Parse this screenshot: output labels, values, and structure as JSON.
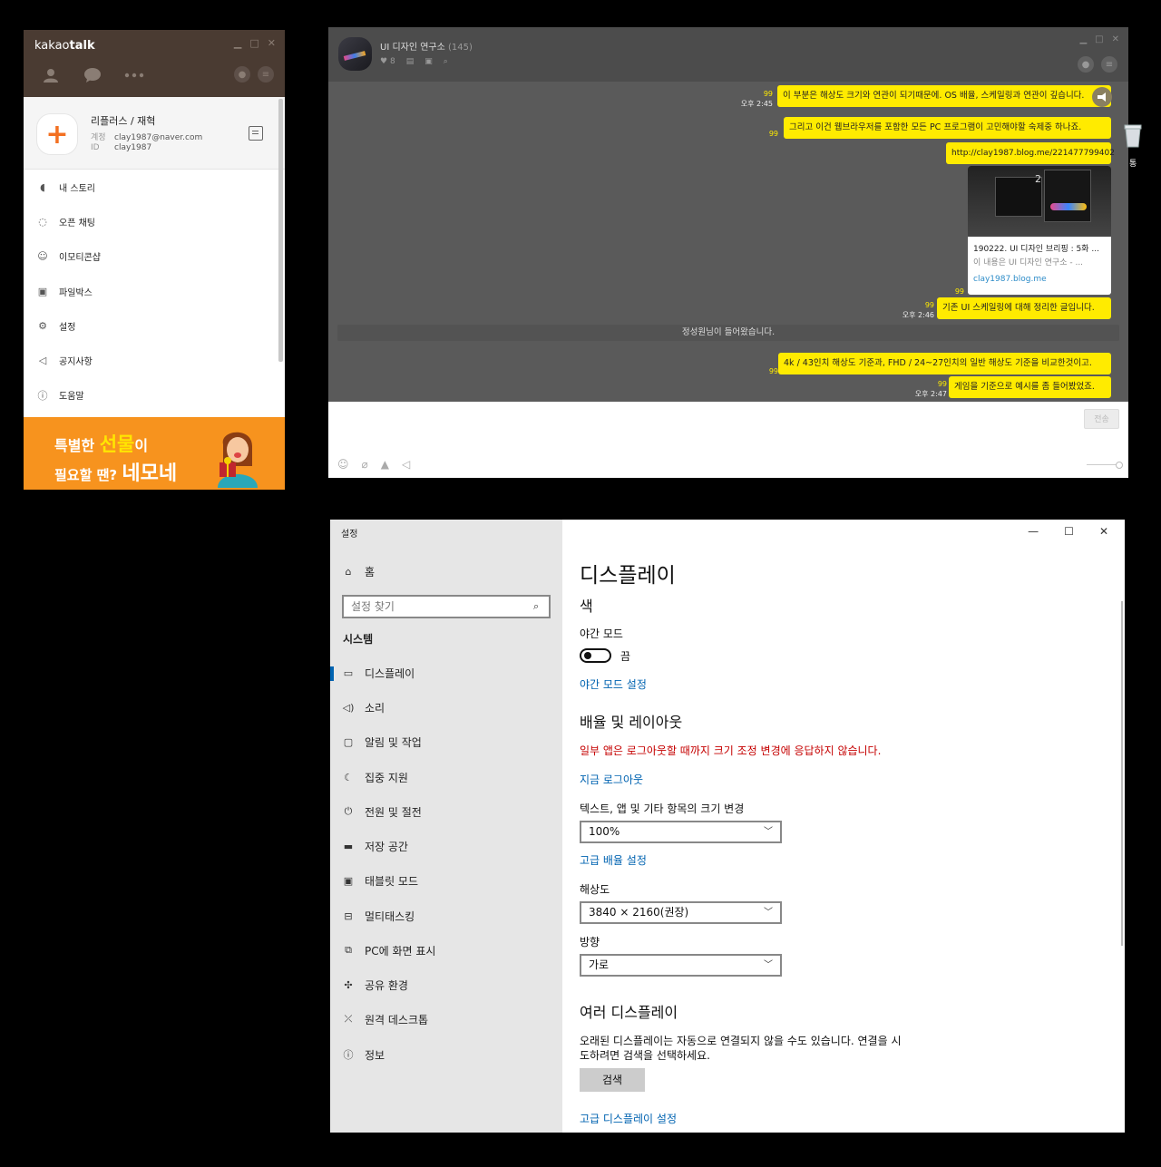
{
  "kakao": {
    "logo_prefix": "kakao",
    "logo_bold": "talk",
    "profile": {
      "name": "리플러스 / 재혁",
      "account_label": "계정",
      "account": "clay1987@naver.com",
      "id_label": "ID",
      "id": "clay1987"
    },
    "menu": [
      {
        "label": "내 스토리",
        "icon": "story-icon"
      },
      {
        "label": "오픈 채팅",
        "icon": "open-chat-icon"
      },
      {
        "label": "이모티콘샵",
        "icon": "emoticon-icon"
      },
      {
        "label": "파일박스",
        "icon": "filebox-icon"
      },
      {
        "label": "설정",
        "icon": "gear-icon"
      },
      {
        "label": "공지사항",
        "icon": "megaphone-icon"
      },
      {
        "label": "도움말",
        "icon": "help-icon"
      }
    ],
    "banner": {
      "line1_pre": "특별한 ",
      "line1_hi": "선물",
      "line1_post": "이",
      "line2_pre": "필요할 땐? ",
      "line2_big": "네모네"
    },
    "colors": {
      "header": "#4a3b32",
      "banner": "#f7931e",
      "accent": "#f37021"
    }
  },
  "chat": {
    "title": "UI 디자인 연구소",
    "member_count": "(145)",
    "likes": "8",
    "messages": [
      {
        "text": "이 부분은 해상도 크기와 연관이 되기때문에. OS 배율, 스케일링과 연관이 깊습니다.",
        "time": "오후 2:45",
        "read": "99"
      },
      {
        "text": "그리고 이건 웹브라우저를 포함한 모든 PC 프로그램이 고민해야할 숙제중 하나죠.",
        "time": "",
        "read": "99"
      },
      {
        "text": "http://clay1987.blog.me/221477799402",
        "time": "",
        "read": ""
      },
      {
        "text": "기존 UI 스케일링에 대해 정리한 글입니다.",
        "time": "오후 2:46",
        "read": "99"
      },
      {
        "text": "4k / 43인치 해상도 기준과, FHD / 24~27인치의 일반 해상도 기준을 비교한것이고.",
        "time": "",
        "read": "99"
      },
      {
        "text": "게임을 기준으로 예시를 좀 들어봤었죠.",
        "time": "오후 2:47",
        "read": "99"
      }
    ],
    "link_card": {
      "thumb_number": "2",
      "title": "190222. UI 디자인 브리핑 : 5화 ...",
      "desc": "이 내용은 UI 디자인 연구소 - ...",
      "url": "clay1987.blog.me",
      "read": "99"
    },
    "notice": "정성원님이 들어왔습니다.",
    "send_label": "전송",
    "colors": {
      "bubble": "#ffeb00",
      "background": "#5a5a5a"
    }
  },
  "desktop": {
    "trash_label": "통"
  },
  "settings": {
    "app_title": "설정",
    "home": "홈",
    "search_placeholder": "설정 찾기",
    "section": "시스템",
    "nav": [
      {
        "label": "디스플레이",
        "icon": "monitor-icon"
      },
      {
        "label": "소리",
        "icon": "speaker-icon"
      },
      {
        "label": "알림 및 작업",
        "icon": "notification-icon"
      },
      {
        "label": "집중 지원",
        "icon": "moon-icon"
      },
      {
        "label": "전원 및 절전",
        "icon": "power-icon"
      },
      {
        "label": "저장 공간",
        "icon": "storage-icon"
      },
      {
        "label": "태블릿 모드",
        "icon": "tablet-icon"
      },
      {
        "label": "멀티태스킹",
        "icon": "multitask-icon"
      },
      {
        "label": "PC에 화면 표시",
        "icon": "project-icon"
      },
      {
        "label": "공유 환경",
        "icon": "share-icon"
      },
      {
        "label": "원격 데스크톱",
        "icon": "remote-icon"
      },
      {
        "label": "정보",
        "icon": "info-icon"
      }
    ],
    "page_title": "디스플레이",
    "color_heading": "색",
    "night_mode_label": "야간 모드",
    "night_mode_state": "끔",
    "night_mode_link": "야간 모드 설정",
    "layout_heading": "배율 및 레이아웃",
    "warning": "일부 앱은 로그아웃할 때까지 크기 조정 변경에 응답하지 않습니다.",
    "logout_link": "지금 로그아웃",
    "scale_label": "텍스트, 앱 및 기타 항목의 크기 변경",
    "scale_value": "100%",
    "advanced_scale_link": "고급 배율 설정",
    "resolution_label": "해상도",
    "resolution_value": "3840 × 2160(권장)",
    "orientation_label": "방향",
    "orientation_value": "가로",
    "multi_heading": "여러 디스플레이",
    "multi_desc": "오래된 디스플레이는 자동으로 연결되지 않을 수도 있습니다. 연결을 시도하려면 검색을 선택하세요.",
    "detect_button": "검색",
    "advanced_display_link": "고급 디스플레이 설정",
    "colors": {
      "sidebar": "#e6e6e6",
      "link": "#0063b1",
      "warning": "#c50000"
    }
  }
}
